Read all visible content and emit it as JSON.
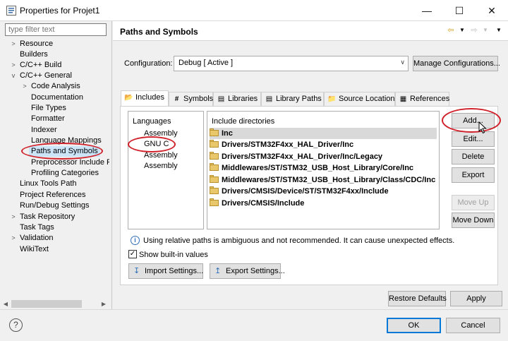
{
  "window": {
    "title": "Properties for Projet1",
    "minimize": "—",
    "maximize": "☐",
    "close": "✕"
  },
  "filter": {
    "placeholder": "type filter text"
  },
  "tree": {
    "resource": "Resource",
    "builders": "Builders",
    "cpp_build": "C/C++ Build",
    "cpp_general": "C/C++ General",
    "code_analysis": "Code Analysis",
    "documentation": "Documentation",
    "file_types": "File Types",
    "formatter": "Formatter",
    "indexer": "Indexer",
    "language_mappings": "Language Mappings",
    "paths_and_symbols": "Paths and Symbols",
    "preprocessor": "Preprocessor Include Pa",
    "profiling": "Profiling Categories",
    "linux_tools": "Linux Tools Path",
    "project_references": "Project References",
    "run_debug": "Run/Debug Settings",
    "task_repository": "Task Repository",
    "task_tags": "Task Tags",
    "validation": "Validation",
    "wikitext": "WikiText"
  },
  "page": {
    "title": "Paths and Symbols"
  },
  "config": {
    "label": "Configuration:",
    "value": "Debug  [ Active ]",
    "manage": "Manage Configurations..."
  },
  "tabs": {
    "includes": "Includes",
    "symbols": "Symbols",
    "libraries": "Libraries",
    "library_paths": "Library Paths",
    "source_location": "Source Location",
    "references": "References"
  },
  "languages": {
    "header": "Languages",
    "items": [
      "Assembly",
      "GNU C",
      "Assembly",
      "Assembly"
    ]
  },
  "includes": {
    "header": "Include directories",
    "items": [
      "Inc",
      "Drivers/STM32F4xx_HAL_Driver/Inc",
      "Drivers/STM32F4xx_HAL_Driver/Inc/Legacy",
      "Middlewares/ST/STM32_USB_Host_Library/Core/Inc",
      "Middlewares/ST/STM32_USB_Host_Library/Class/CDC/Inc",
      "Drivers/CMSIS/Device/ST/STM32F4xx/Include",
      "Drivers/CMSIS/Include"
    ]
  },
  "buttons": {
    "add": "Add...",
    "edit": "Edit...",
    "delete": "Delete",
    "export": "Export",
    "move_up": "Move Up",
    "move_down": "Move Down",
    "import_settings": "Import Settings...",
    "export_settings": "Export Settings...",
    "restore_defaults": "Restore Defaults",
    "apply": "Apply",
    "ok": "OK",
    "cancel": "Cancel"
  },
  "info": {
    "text": "Using relative paths is ambiguous and not recommended. It can cause unexpected effects."
  },
  "show_builtin": {
    "label": "Show built-in values",
    "checked": true
  },
  "help": "?",
  "colors": {
    "selection": "#cce4f7",
    "accent": "#0078d7",
    "annotation": "#d0202a"
  }
}
